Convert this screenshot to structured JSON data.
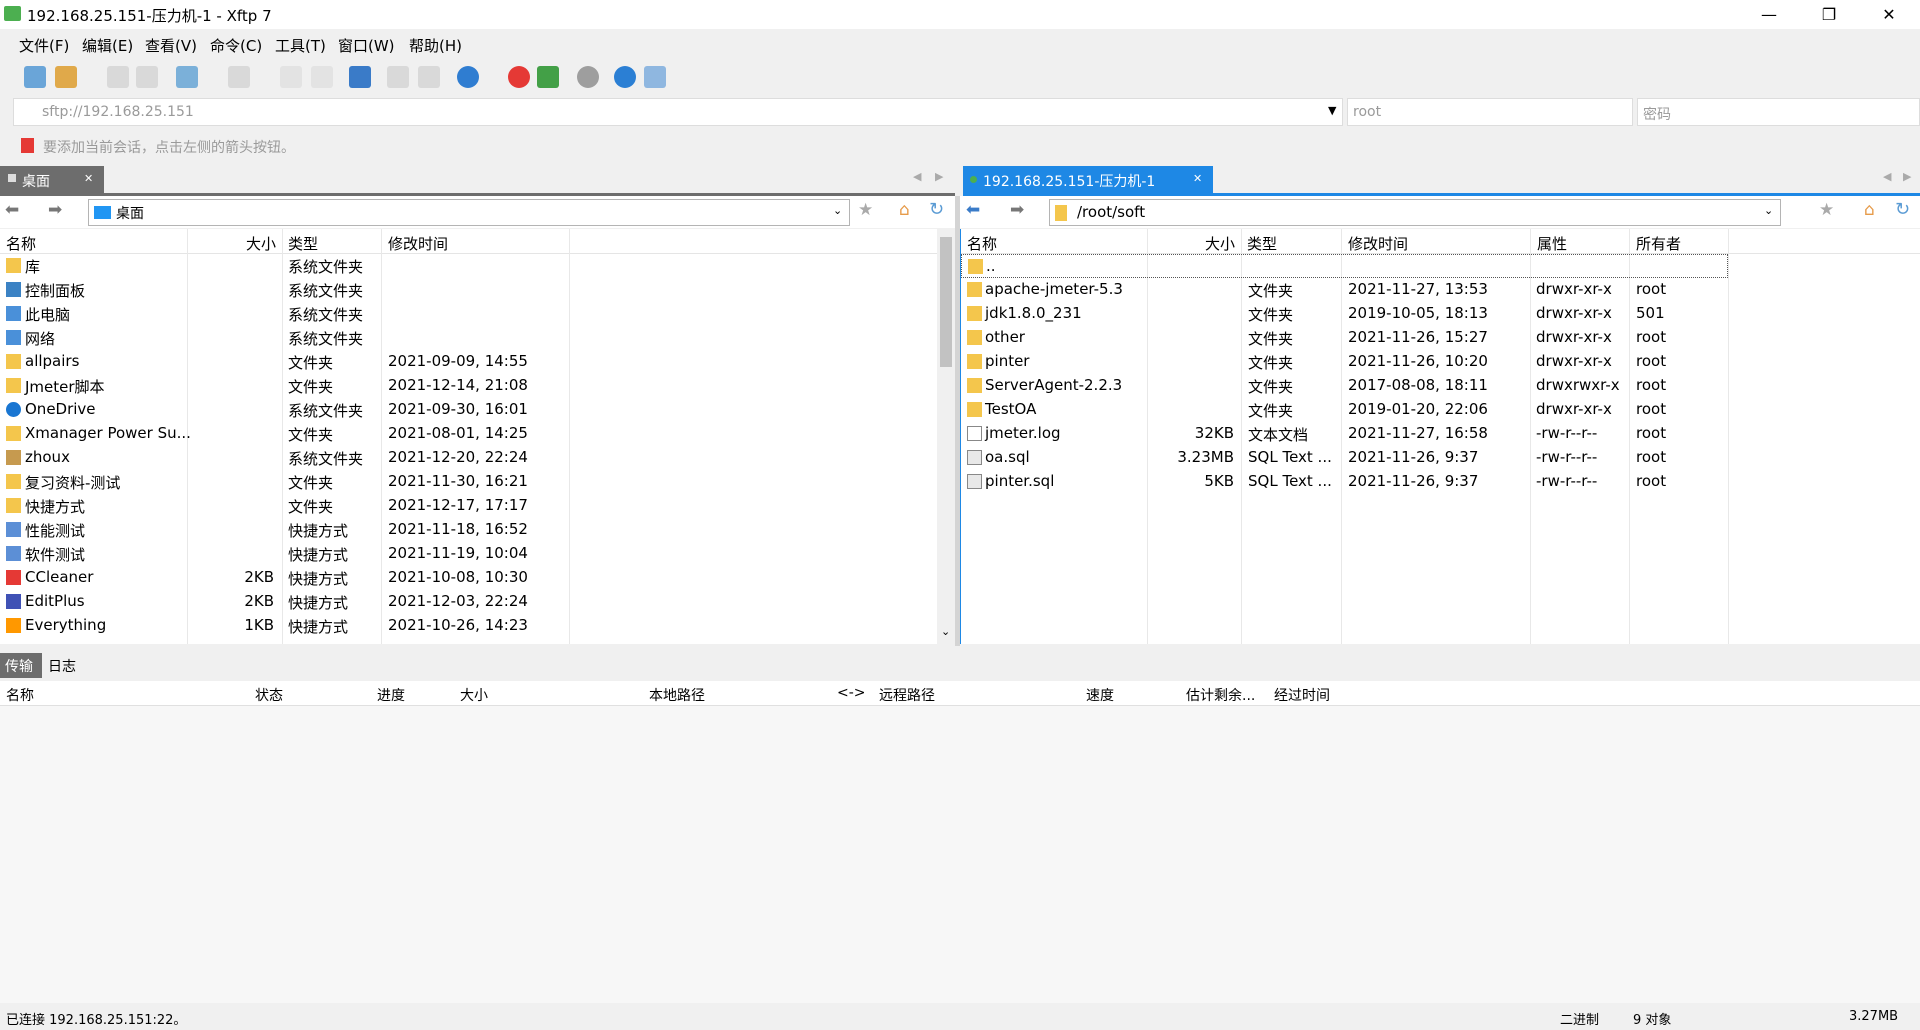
{
  "window": {
    "title": "192.168.25.151-压力机-1 - Xftp 7",
    "minimize": "—",
    "maximize": "❐",
    "close": "✕"
  },
  "menu": [
    "文件(F)",
    "编辑(E)",
    "查看(V)",
    "命令(C)",
    "工具(T)",
    "窗口(W)",
    "帮助(H)"
  ],
  "address": {
    "host": "sftp://192.168.25.151",
    "user_placeholder": "root",
    "password_placeholder": "密码"
  },
  "session_hint": "要添加当前会话，点击左侧的箭头按钮。",
  "left": {
    "tab_label": "桌面",
    "path": "桌面",
    "columns": [
      "名称",
      "大小",
      "类型",
      "修改时间"
    ],
    "rows": [
      {
        "name": "库",
        "size": "",
        "type": "系统文件夹",
        "modified": "",
        "icon": "library"
      },
      {
        "name": "控制面板",
        "size": "",
        "type": "系统文件夹",
        "modified": "",
        "icon": "control-panel"
      },
      {
        "name": "此电脑",
        "size": "",
        "type": "系统文件夹",
        "modified": "",
        "icon": "computer"
      },
      {
        "name": "网络",
        "size": "",
        "type": "系统文件夹",
        "modified": "",
        "icon": "network"
      },
      {
        "name": "allpairs",
        "size": "",
        "type": "文件夹",
        "modified": "2021-09-09, 14:55",
        "icon": "folder"
      },
      {
        "name": "Jmeter脚本",
        "size": "",
        "type": "文件夹",
        "modified": "2021-12-14, 21:08",
        "icon": "folder"
      },
      {
        "name": "OneDrive",
        "size": "",
        "type": "系统文件夹",
        "modified": "2021-09-30, 16:01",
        "icon": "cloud"
      },
      {
        "name": "Xmanager Power Su...",
        "size": "",
        "type": "文件夹",
        "modified": "2021-08-01, 14:25",
        "icon": "folder"
      },
      {
        "name": "zhoux",
        "size": "",
        "type": "系统文件夹",
        "modified": "2021-12-20, 22:24",
        "icon": "user"
      },
      {
        "name": "复习资料-测试",
        "size": "",
        "type": "文件夹",
        "modified": "2021-11-30, 16:21",
        "icon": "folder"
      },
      {
        "name": "快捷方式",
        "size": "",
        "type": "文件夹",
        "modified": "2021-12-17, 17:17",
        "icon": "folder"
      },
      {
        "name": "性能测试",
        "size": "",
        "type": "快捷方式",
        "modified": "2021-11-18, 16:52",
        "icon": "shortcut"
      },
      {
        "name": "软件测试",
        "size": "",
        "type": "快捷方式",
        "modified": "2021-11-19, 10:04",
        "icon": "shortcut"
      },
      {
        "name": "CCleaner",
        "size": "2KB",
        "type": "快捷方式",
        "modified": "2021-10-08, 10:30",
        "icon": "ccleaner"
      },
      {
        "name": "EditPlus",
        "size": "2KB",
        "type": "快捷方式",
        "modified": "2021-12-03, 22:24",
        "icon": "editplus"
      },
      {
        "name": "Everything",
        "size": "1KB",
        "type": "快捷方式",
        "modified": "2021-10-26, 14:23",
        "icon": "everything"
      }
    ]
  },
  "right": {
    "tab_label": "192.168.25.151-压力机-1",
    "path": "/root/soft",
    "columns": [
      "名称",
      "大小",
      "类型",
      "修改时间",
      "属性",
      "所有者"
    ],
    "rows": [
      {
        "name": "..",
        "size": "",
        "type": "",
        "modified": "",
        "attr": "",
        "owner": "",
        "icon": "folder"
      },
      {
        "name": "apache-jmeter-5.3",
        "size": "",
        "type": "文件夹",
        "modified": "2021-11-27, 13:53",
        "attr": "drwxr-xr-x",
        "owner": "root",
        "icon": "folder"
      },
      {
        "name": "jdk1.8.0_231",
        "size": "",
        "type": "文件夹",
        "modified": "2019-10-05, 18:13",
        "attr": "drwxr-xr-x",
        "owner": "501",
        "icon": "folder"
      },
      {
        "name": "other",
        "size": "",
        "type": "文件夹",
        "modified": "2021-11-26, 15:27",
        "attr": "drwxr-xr-x",
        "owner": "root",
        "icon": "folder"
      },
      {
        "name": "pinter",
        "size": "",
        "type": "文件夹",
        "modified": "2021-11-26, 10:20",
        "attr": "drwxr-xr-x",
        "owner": "root",
        "icon": "folder"
      },
      {
        "name": "ServerAgent-2.2.3",
        "size": "",
        "type": "文件夹",
        "modified": "2017-08-08, 18:11",
        "attr": "drwxrwxr-x",
        "owner": "root",
        "icon": "folder"
      },
      {
        "name": "TestOA",
        "size": "",
        "type": "文件夹",
        "modified": "2019-01-20, 22:06",
        "attr": "drwxr-xr-x",
        "owner": "root",
        "icon": "folder"
      },
      {
        "name": "jmeter.log",
        "size": "32KB",
        "type": "文本文档",
        "modified": "2021-11-27, 16:58",
        "attr": "-rw-r--r--",
        "owner": "root",
        "icon": "file"
      },
      {
        "name": "oa.sql",
        "size": "3.23MB",
        "type": "SQL Text ...",
        "modified": "2021-11-26, 9:37",
        "attr": "-rw-r--r--",
        "owner": "root",
        "icon": "sqlfile"
      },
      {
        "name": "pinter.sql",
        "size": "5KB",
        "type": "SQL Text ...",
        "modified": "2021-11-26, 9:37",
        "attr": "-rw-r--r--",
        "owner": "root",
        "icon": "sqlfile"
      }
    ]
  },
  "bottom_tabs": [
    "传输",
    "日志"
  ],
  "transfer_columns": [
    "名称",
    "状态",
    "进度",
    "大小",
    "本地路径",
    "<->",
    "远程路径",
    "速度",
    "估计剩余...",
    "经过时间"
  ],
  "status": {
    "connection": "已连接 192.168.25.151:22。",
    "mode": "二进制",
    "objects": "9 对象",
    "size": "3.27MB"
  },
  "colors": {
    "accent": "#1e88e5",
    "left_tab": "#6d6d6d",
    "folder": "#f4c64c"
  }
}
